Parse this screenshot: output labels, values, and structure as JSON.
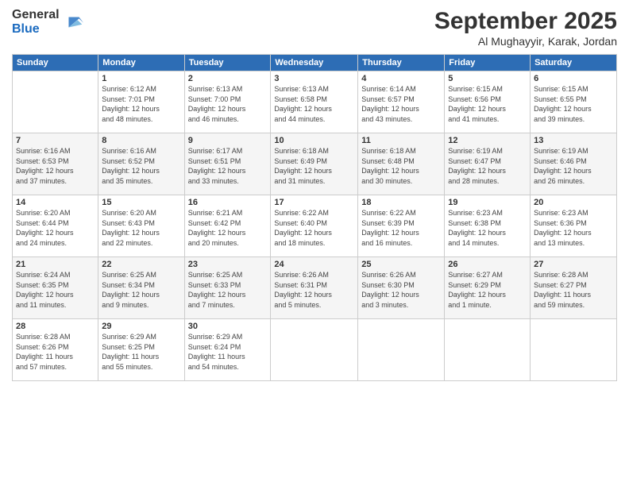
{
  "logo": {
    "line1": "General",
    "line2": "Blue"
  },
  "title": "September 2025",
  "location": "Al Mughayyir, Karak, Jordan",
  "days_header": [
    "Sunday",
    "Monday",
    "Tuesday",
    "Wednesday",
    "Thursday",
    "Friday",
    "Saturday"
  ],
  "weeks": [
    [
      {
        "num": "",
        "info": ""
      },
      {
        "num": "1",
        "info": "Sunrise: 6:12 AM\nSunset: 7:01 PM\nDaylight: 12 hours\nand 48 minutes."
      },
      {
        "num": "2",
        "info": "Sunrise: 6:13 AM\nSunset: 7:00 PM\nDaylight: 12 hours\nand 46 minutes."
      },
      {
        "num": "3",
        "info": "Sunrise: 6:13 AM\nSunset: 6:58 PM\nDaylight: 12 hours\nand 44 minutes."
      },
      {
        "num": "4",
        "info": "Sunrise: 6:14 AM\nSunset: 6:57 PM\nDaylight: 12 hours\nand 43 minutes."
      },
      {
        "num": "5",
        "info": "Sunrise: 6:15 AM\nSunset: 6:56 PM\nDaylight: 12 hours\nand 41 minutes."
      },
      {
        "num": "6",
        "info": "Sunrise: 6:15 AM\nSunset: 6:55 PM\nDaylight: 12 hours\nand 39 minutes."
      }
    ],
    [
      {
        "num": "7",
        "info": "Sunrise: 6:16 AM\nSunset: 6:53 PM\nDaylight: 12 hours\nand 37 minutes."
      },
      {
        "num": "8",
        "info": "Sunrise: 6:16 AM\nSunset: 6:52 PM\nDaylight: 12 hours\nand 35 minutes."
      },
      {
        "num": "9",
        "info": "Sunrise: 6:17 AM\nSunset: 6:51 PM\nDaylight: 12 hours\nand 33 minutes."
      },
      {
        "num": "10",
        "info": "Sunrise: 6:18 AM\nSunset: 6:49 PM\nDaylight: 12 hours\nand 31 minutes."
      },
      {
        "num": "11",
        "info": "Sunrise: 6:18 AM\nSunset: 6:48 PM\nDaylight: 12 hours\nand 30 minutes."
      },
      {
        "num": "12",
        "info": "Sunrise: 6:19 AM\nSunset: 6:47 PM\nDaylight: 12 hours\nand 28 minutes."
      },
      {
        "num": "13",
        "info": "Sunrise: 6:19 AM\nSunset: 6:46 PM\nDaylight: 12 hours\nand 26 minutes."
      }
    ],
    [
      {
        "num": "14",
        "info": "Sunrise: 6:20 AM\nSunset: 6:44 PM\nDaylight: 12 hours\nand 24 minutes."
      },
      {
        "num": "15",
        "info": "Sunrise: 6:20 AM\nSunset: 6:43 PM\nDaylight: 12 hours\nand 22 minutes."
      },
      {
        "num": "16",
        "info": "Sunrise: 6:21 AM\nSunset: 6:42 PM\nDaylight: 12 hours\nand 20 minutes."
      },
      {
        "num": "17",
        "info": "Sunrise: 6:22 AM\nSunset: 6:40 PM\nDaylight: 12 hours\nand 18 minutes."
      },
      {
        "num": "18",
        "info": "Sunrise: 6:22 AM\nSunset: 6:39 PM\nDaylight: 12 hours\nand 16 minutes."
      },
      {
        "num": "19",
        "info": "Sunrise: 6:23 AM\nSunset: 6:38 PM\nDaylight: 12 hours\nand 14 minutes."
      },
      {
        "num": "20",
        "info": "Sunrise: 6:23 AM\nSunset: 6:36 PM\nDaylight: 12 hours\nand 13 minutes."
      }
    ],
    [
      {
        "num": "21",
        "info": "Sunrise: 6:24 AM\nSunset: 6:35 PM\nDaylight: 12 hours\nand 11 minutes."
      },
      {
        "num": "22",
        "info": "Sunrise: 6:25 AM\nSunset: 6:34 PM\nDaylight: 12 hours\nand 9 minutes."
      },
      {
        "num": "23",
        "info": "Sunrise: 6:25 AM\nSunset: 6:33 PM\nDaylight: 12 hours\nand 7 minutes."
      },
      {
        "num": "24",
        "info": "Sunrise: 6:26 AM\nSunset: 6:31 PM\nDaylight: 12 hours\nand 5 minutes."
      },
      {
        "num": "25",
        "info": "Sunrise: 6:26 AM\nSunset: 6:30 PM\nDaylight: 12 hours\nand 3 minutes."
      },
      {
        "num": "26",
        "info": "Sunrise: 6:27 AM\nSunset: 6:29 PM\nDaylight: 12 hours\nand 1 minute."
      },
      {
        "num": "27",
        "info": "Sunrise: 6:28 AM\nSunset: 6:27 PM\nDaylight: 11 hours\nand 59 minutes."
      }
    ],
    [
      {
        "num": "28",
        "info": "Sunrise: 6:28 AM\nSunset: 6:26 PM\nDaylight: 11 hours\nand 57 minutes."
      },
      {
        "num": "29",
        "info": "Sunrise: 6:29 AM\nSunset: 6:25 PM\nDaylight: 11 hours\nand 55 minutes."
      },
      {
        "num": "30",
        "info": "Sunrise: 6:29 AM\nSunset: 6:24 PM\nDaylight: 11 hours\nand 54 minutes."
      },
      {
        "num": "",
        "info": ""
      },
      {
        "num": "",
        "info": ""
      },
      {
        "num": "",
        "info": ""
      },
      {
        "num": "",
        "info": ""
      }
    ]
  ]
}
